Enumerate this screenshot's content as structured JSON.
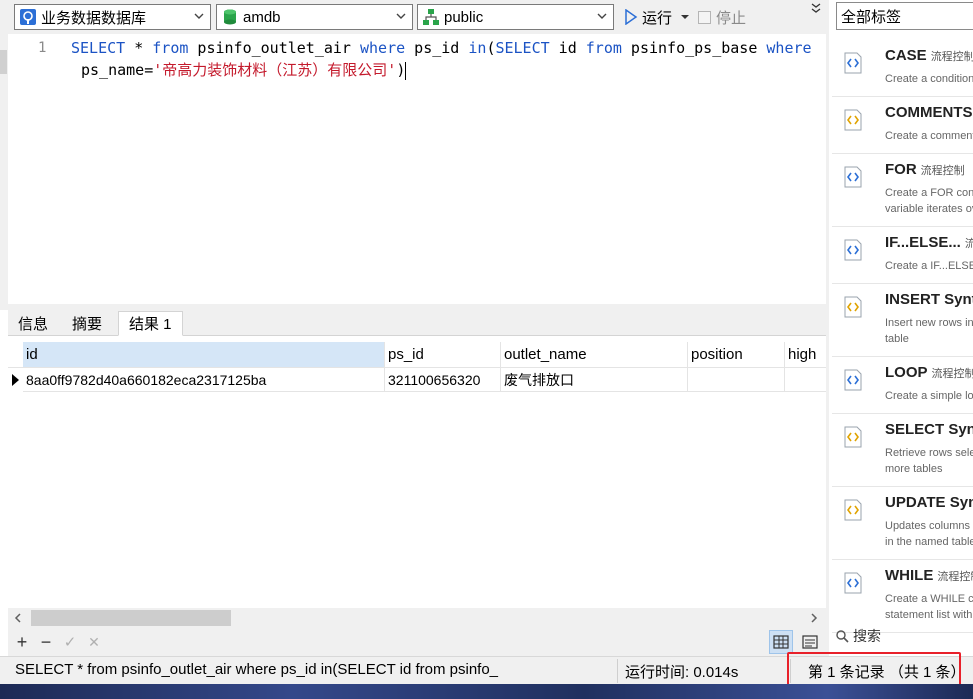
{
  "toolbar": {
    "connection": "业务数据数据库",
    "database": "amdb",
    "schema": "public",
    "run_label": "运行",
    "stop_label": "停止"
  },
  "editor": {
    "line_number": "1",
    "sql_line1": [
      {
        "t": "SELECT",
        "c": "kw"
      },
      {
        "t": " * ",
        "c": "plain"
      },
      {
        "t": "from",
        "c": "kw"
      },
      {
        "t": " psinfo_outlet_air ",
        "c": "plain"
      },
      {
        "t": "where",
        "c": "kw"
      },
      {
        "t": " ps_id ",
        "c": "plain"
      },
      {
        "t": "in",
        "c": "kw"
      },
      {
        "t": "(",
        "c": "plain"
      },
      {
        "t": "SELECT",
        "c": "kw"
      },
      {
        "t": " id ",
        "c": "plain"
      },
      {
        "t": "from",
        "c": "kw"
      },
      {
        "t": " psinfo_ps_base ",
        "c": "plain"
      },
      {
        "t": "where",
        "c": "kw"
      }
    ],
    "sql_line2": [
      {
        "t": "ps_name=",
        "c": "plain"
      },
      {
        "t": "'帝高力装饰材料（江苏）有限公司'",
        "c": "str"
      },
      {
        "t": ")",
        "c": "plain"
      }
    ]
  },
  "result_tabs": [
    "信息",
    "摘要",
    "结果 1"
  ],
  "active_tab": 2,
  "grid": {
    "columns": [
      "id",
      "ps_id",
      "outlet_name",
      "position",
      "high"
    ],
    "rows": [
      [
        "8aa0ff9782d40a660182eca2317125ba",
        "321100656320",
        "废气排放口",
        "",
        ""
      ]
    ]
  },
  "gridbar": {
    "add": "+",
    "remove": "−",
    "apply": "✓",
    "discard": "✕"
  },
  "status": {
    "sql": "SELECT * from psinfo_outlet_air where ps_id in(SELECT id from psinfo_",
    "time": "运行时间: 0.014s",
    "records": "第 1 条记录 （共 1 条）"
  },
  "snippets": {
    "filter": "全部标签",
    "search_placeholder": "搜索",
    "items": [
      {
        "title": "CASE",
        "category": "流程控制",
        "desc": [
          "Create a conditional"
        ],
        "icon": "blue"
      },
      {
        "title": "COMMENTS",
        "category": "",
        "desc": [
          "Create a comment"
        ],
        "icon": "yellow"
      },
      {
        "title": "FOR",
        "category": "流程控制",
        "desc": [
          "Create a FOR control",
          "variable iterates over"
        ],
        "icon": "blue"
      },
      {
        "title": "IF...ELSE...",
        "category": "流程控制",
        "desc": [
          "Create a IF...ELSE"
        ],
        "icon": "blue"
      },
      {
        "title": "INSERT Syntax",
        "category": "",
        "desc": [
          "Insert new rows into",
          "table"
        ],
        "icon": "yellow"
      },
      {
        "title": "LOOP",
        "category": "流程控制",
        "desc": [
          "Create a simple loop"
        ],
        "icon": "blue"
      },
      {
        "title": "SELECT Syntax",
        "category": "",
        "desc": [
          "Retrieve rows selected",
          "more tables"
        ],
        "icon": "yellow"
      },
      {
        "title": "UPDATE Syntax",
        "category": "",
        "desc": [
          "Updates columns of",
          "in the named table"
        ],
        "icon": "yellow"
      },
      {
        "title": "WHILE",
        "category": "流程控制",
        "desc": [
          "Create a WHILE control",
          "statement list with"
        ],
        "icon": "blue"
      }
    ]
  }
}
